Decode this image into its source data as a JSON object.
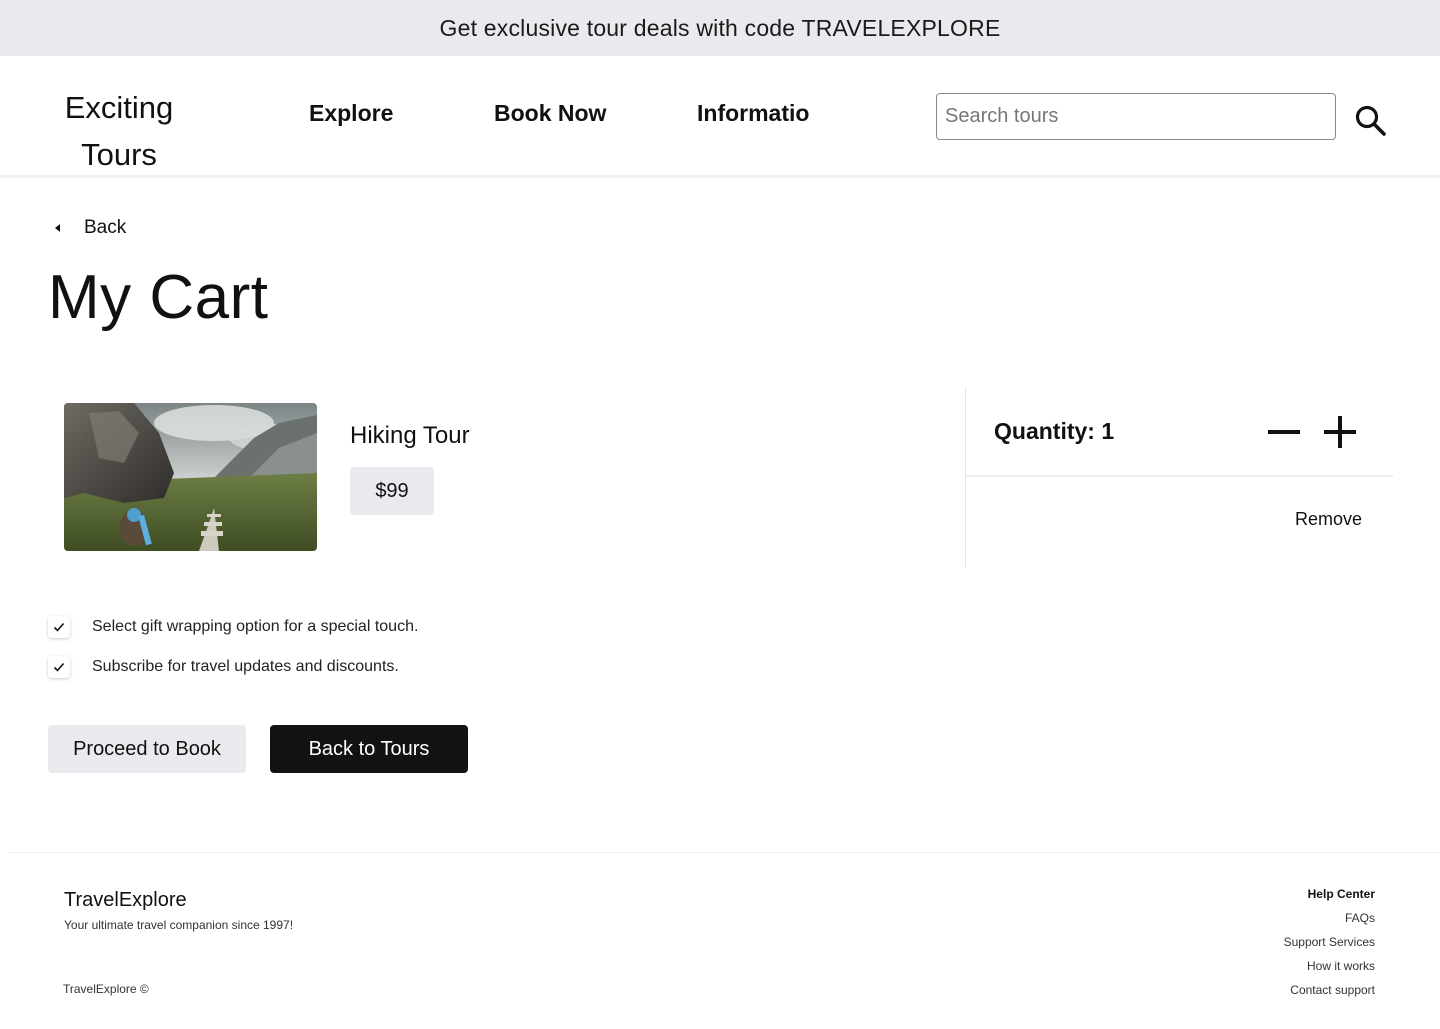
{
  "promo_banner": {
    "text": "Get exclusive tour deals with code TRAVELEXPLORE"
  },
  "header": {
    "logo_line1": "Exciting",
    "logo_line2": "Tours",
    "nav": [
      {
        "label": "Explore"
      },
      {
        "label": "Book Now"
      },
      {
        "label": "Informatio"
      }
    ],
    "search": {
      "placeholder": "Search tours",
      "value": "",
      "icon": "search-icon"
    }
  },
  "page": {
    "back_label": "Back",
    "title": "My Cart"
  },
  "cart_item": {
    "image": "hiking-trail-photo",
    "name": "Hiking Tour",
    "price": "$99",
    "quantity_label": "Quantity: 1",
    "remove_label": "Remove"
  },
  "options": [
    {
      "label": "Select gift wrapping option for a special touch.",
      "checked": true
    },
    {
      "label": "Subscribe for travel updates and discounts.",
      "checked": true
    }
  ],
  "actions": {
    "proceed_label": "Proceed to Book",
    "back_to_tours_label": "Back to Tours"
  },
  "footer": {
    "brand": "TravelExplore",
    "tagline": "Your ultimate travel companion since 1997!",
    "copyright": "TravelExplore ©",
    "links_heading": "Help Center",
    "links": [
      "FAQs",
      "Support Services",
      "How it works",
      "Contact support"
    ]
  },
  "colors": {
    "banner_bg": "#e9eaed",
    "primary_button": "#121212",
    "secondary_button": "#e9eaed"
  }
}
